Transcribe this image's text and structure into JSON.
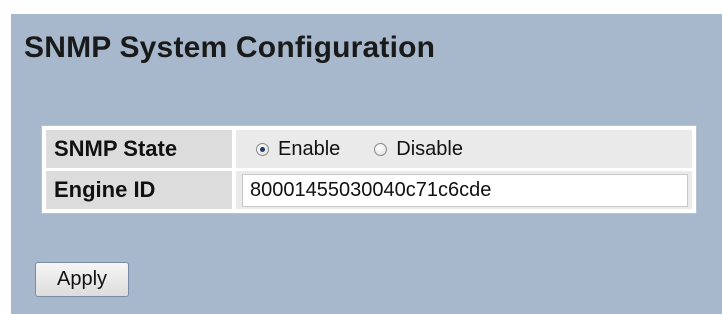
{
  "page": {
    "title": "SNMP System Configuration"
  },
  "snmp_state": {
    "label": "SNMP State",
    "options": [
      {
        "label": "Enable",
        "selected": true
      },
      {
        "label": "Disable",
        "selected": false
      }
    ]
  },
  "engine_id": {
    "label": "Engine ID",
    "value": "80001455030040c71c6cde"
  },
  "actions": {
    "apply_label": "Apply"
  },
  "colors": {
    "panel_background": "#a7b8cc",
    "label_cell_background": "#dcdcdc",
    "value_cell_background": "#eaeaea"
  }
}
